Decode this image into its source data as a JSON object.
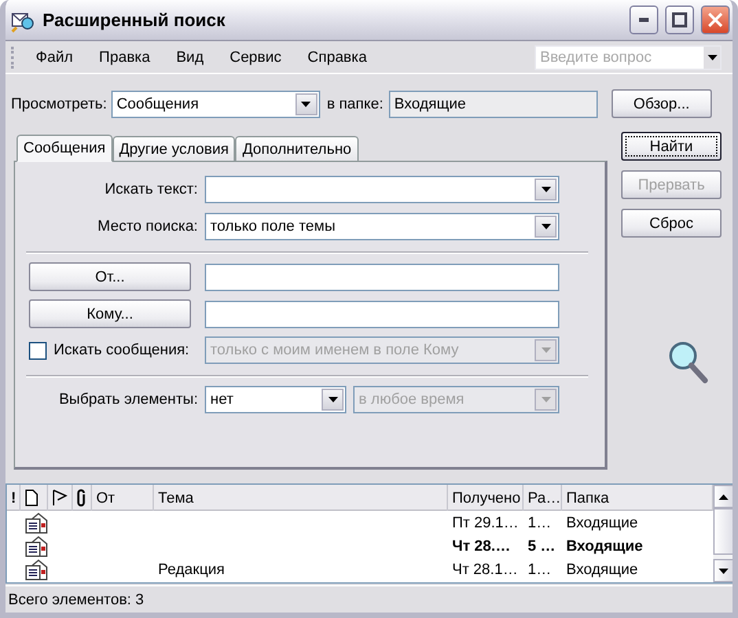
{
  "window": {
    "title": "Расширенный поиск"
  },
  "menu": [
    "Файл",
    "Правка",
    "Вид",
    "Сервис",
    "Справка"
  ],
  "question_box": {
    "placeholder": "Введите вопрос"
  },
  "look_in": {
    "label": "Просмотреть:",
    "value": "Сообщения"
  },
  "folder": {
    "label": "в папке:",
    "value": "Входящие"
  },
  "browse_button": "Обзор...",
  "tabs": [
    {
      "label": "Сообщения",
      "selected": true
    },
    {
      "label": "Другие условия",
      "selected": false
    },
    {
      "label": "Дополнительно",
      "selected": false
    }
  ],
  "actions": [
    {
      "label": "Найти",
      "disabled": false,
      "default": true
    },
    {
      "label": "Прервать",
      "disabled": true,
      "default": false
    },
    {
      "label": "Сброс",
      "disabled": false,
      "default": false
    }
  ],
  "search_text": {
    "label": "Искать текст:"
  },
  "search_in": {
    "label": "Место поиска:",
    "value": "только поле темы"
  },
  "from_button": "От...",
  "to_button": "Кому...",
  "search_messages": {
    "label": "Искать сообщения:",
    "checked": false,
    "value": "только с моим именем в поле Кому",
    "disabled": true
  },
  "select_items": {
    "label": "Выбрать элементы:",
    "value": "нет",
    "time": "в любое время",
    "time_disabled": true
  },
  "results": {
    "columns": [
      "!",
      "От",
      "Тема",
      "Получено",
      "Ра…",
      "Папка"
    ],
    "rows": [
      {
        "received": "Пт 29.1…",
        "size": "1…",
        "folder": "Входящие",
        "unread": false
      },
      {
        "received": "Чт 28.…",
        "size": "5 …",
        "folder": "Входящие",
        "unread": true
      },
      {
        "subject": "Редакция",
        "received": "Чт 28.1…",
        "size": "1…",
        "folder": "Входящие",
        "unread": false
      }
    ]
  },
  "status_bar": "Всего элементов: 3"
}
